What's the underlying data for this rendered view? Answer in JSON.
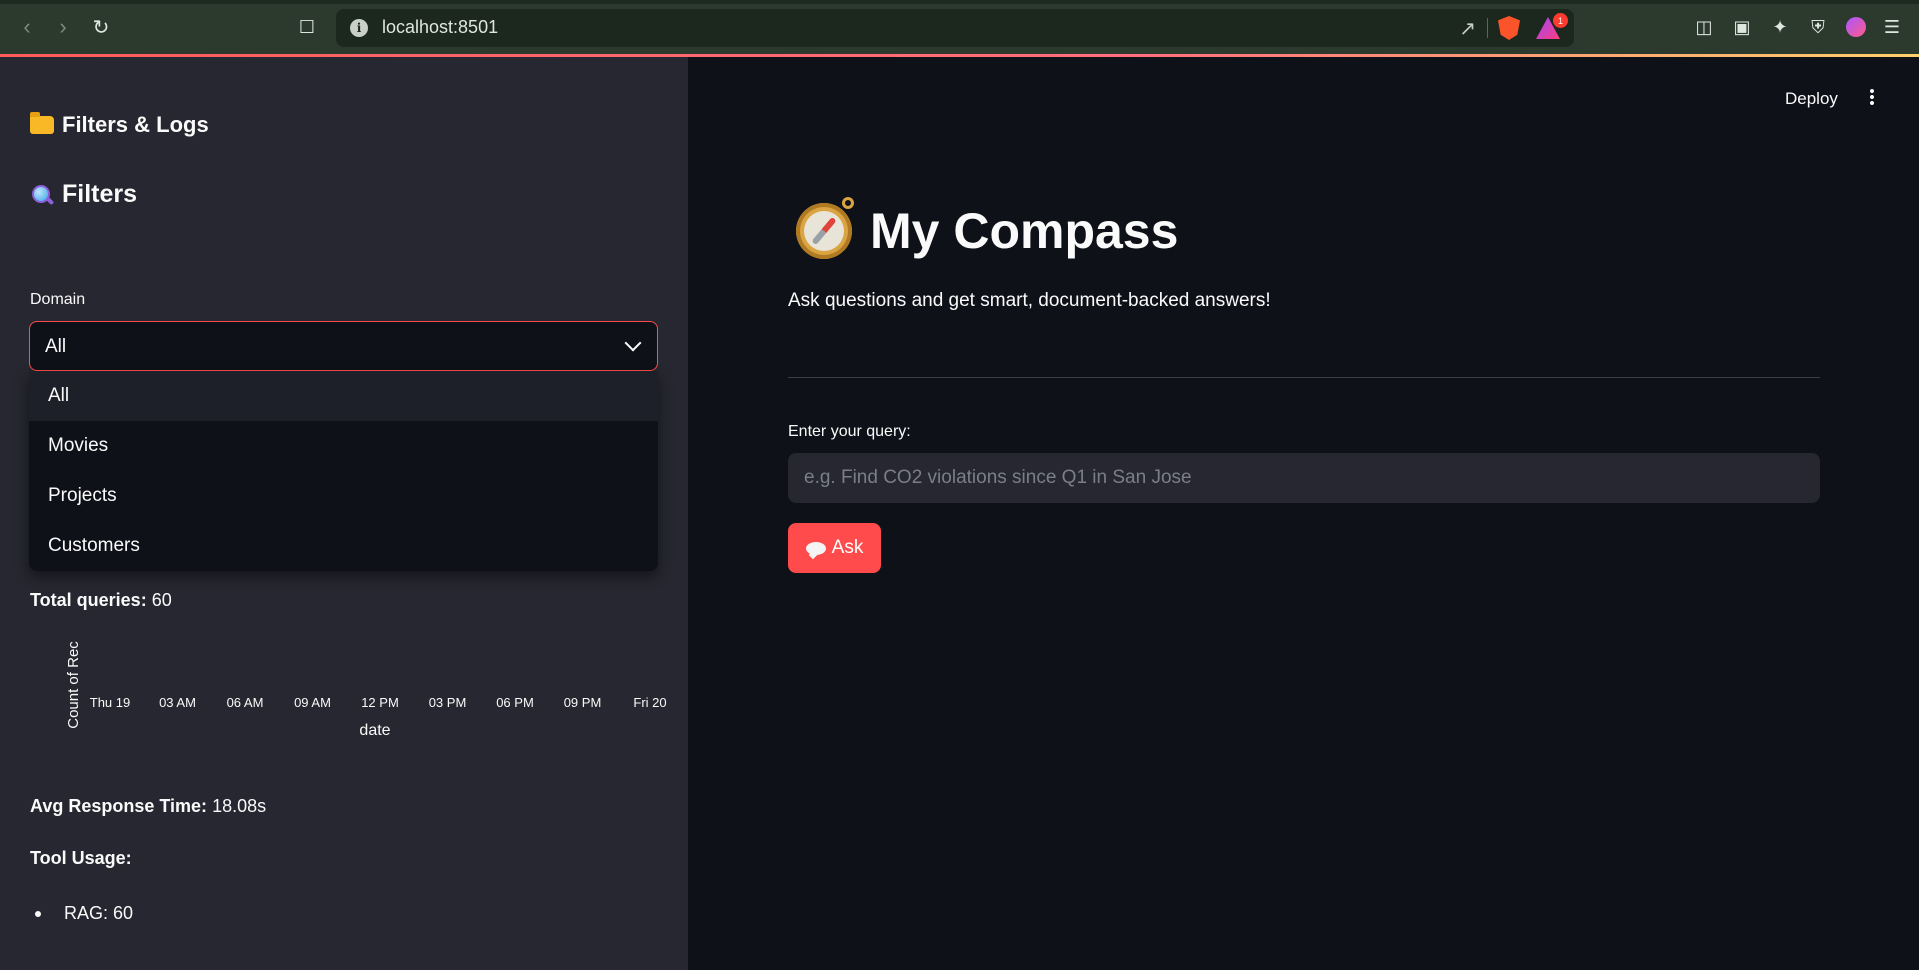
{
  "browser": {
    "url": "localhost:8501",
    "info_glyph": "i",
    "rewards_badge": "1",
    "colors": {
      "accent_line": "#ff5b5b",
      "brave": "#fb542b"
    }
  },
  "header": {
    "deploy_label": "Deploy"
  },
  "sidebar": {
    "title": "Filters & Logs",
    "filters_heading": "Filters",
    "domain_label": "Domain",
    "domain_selected": "All",
    "domain_options": [
      "All",
      "Movies",
      "Projects",
      "Customers"
    ],
    "total_queries_label": "Total queries:",
    "total_queries_value": "60",
    "avg_response_label": "Avg Response Time:",
    "avg_response_value": "18.08s",
    "tool_usage_label": "Tool Usage:",
    "tool_usage_items": [
      "RAG: 60"
    ]
  },
  "chart_data": {
    "type": "line",
    "xlabel": "date",
    "ylabel": "Count of Rec",
    "x_ticks": [
      "Thu 19",
      "03 AM",
      "06 AM",
      "09 AM",
      "12 PM",
      "03 PM",
      "06 PM",
      "09 PM",
      "Fri 20"
    ]
  },
  "main": {
    "title": "My Compass",
    "subtitle": "Ask questions and get smart, document-backed answers!",
    "query_label": "Enter your query:",
    "query_placeholder": "e.g. Find CO2 violations since Q1 in San Jose",
    "query_value": "",
    "ask_label": "Ask",
    "colors": {
      "primary": "#ff4b4b",
      "background": "#0e1117",
      "sidebar": "#262730"
    }
  }
}
